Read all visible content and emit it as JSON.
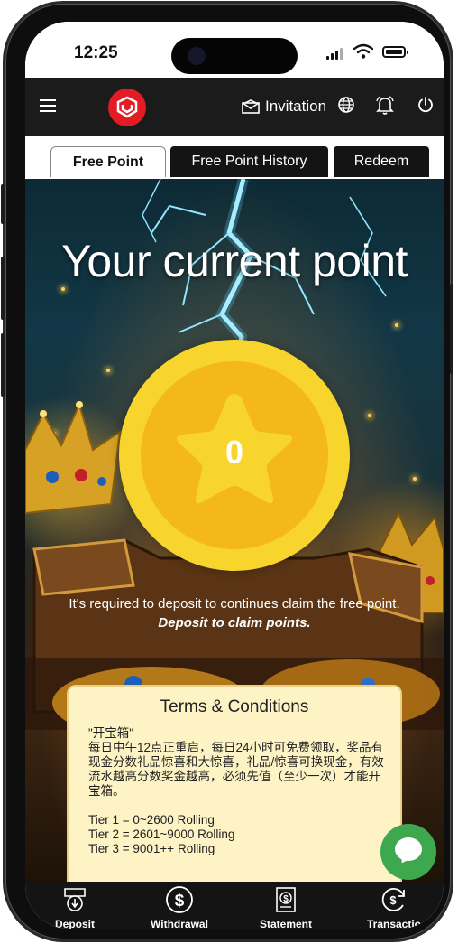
{
  "status": {
    "time": "12:25"
  },
  "header": {
    "invitation_label": "Invitation"
  },
  "tabs": [
    {
      "label": "Free Point"
    },
    {
      "label": "Free Point History"
    },
    {
      "label": "Redeem"
    }
  ],
  "hero": {
    "title": "Your current point",
    "points": "0",
    "message": "It's required to deposit to continues claim the free point.",
    "cta": "Deposit to claim points."
  },
  "terms": {
    "title": "Terms & Conditions",
    "body": "\"开宝箱\"\n每日中午12点正重启，每日24小时可免费领取，奖品有现金分数礼品惊喜和大惊喜，礼品/惊喜可换现金，有效流水越高分数奖金越高，必须先值（至少一次）才能开宝箱。\n\nTier 1 = 0~2600 Rolling\nTier 2 = 2601~9000 Rolling\nTier 3 = 9001++ Rolling"
  },
  "bottom_nav": [
    {
      "label": "Deposit",
      "icon": "deposit-icon"
    },
    {
      "label": "Withdrawal",
      "icon": "dollar-icon"
    },
    {
      "label": "Statement",
      "icon": "statement-icon"
    },
    {
      "label": "Transactio",
      "icon": "transaction-icon"
    }
  ],
  "colors": {
    "appbar": "#1b1b1b",
    "logo": "#e21b24",
    "coin_outer": "#f7d52c",
    "coin_inner": "#f4b818",
    "terms_bg": "#fdf3c5",
    "chat": "#3ea84e"
  }
}
